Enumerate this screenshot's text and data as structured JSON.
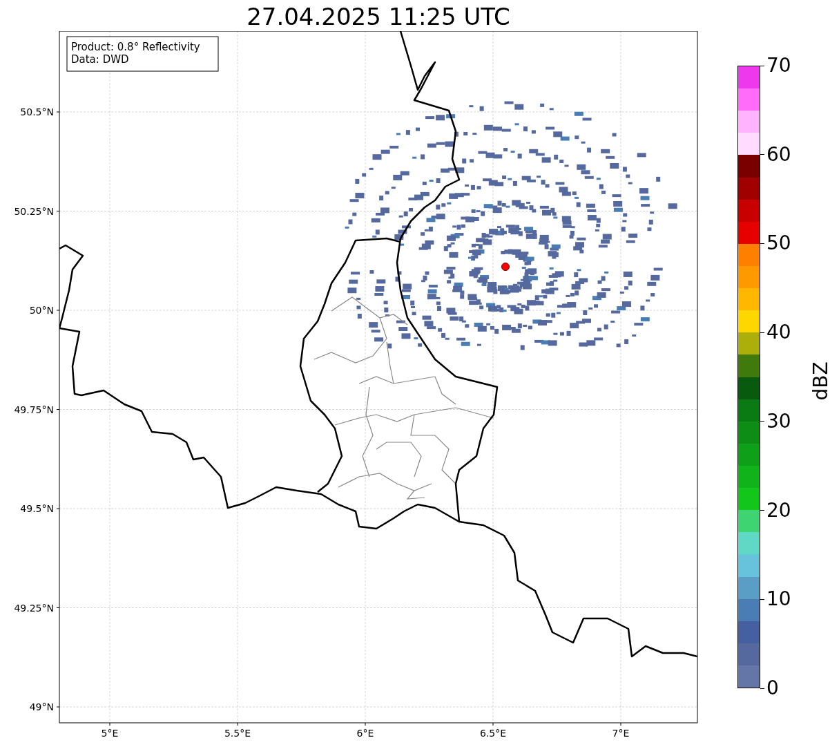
{
  "title": "27.04.2025 11:25 UTC",
  "map": {
    "legend": [
      "Product: 0.8° Reflectivity",
      "Data: DWD"
    ],
    "xticks": [
      "5°E",
      "5.5°E",
      "6°E",
      "6.5°E",
      "7°E"
    ],
    "yticks": [
      "50.5°N",
      "50.25°N",
      "50°N",
      "49.75°N",
      "49.5°N",
      "49.25°N",
      "49°N"
    ]
  },
  "colorbar": {
    "label": "dBZ",
    "ticks": [
      "70",
      "60",
      "50",
      "40",
      "30",
      "20",
      "10",
      "0"
    ],
    "segments": [
      {
        "color": "#ee38ee"
      },
      {
        "color": "#ff6cfa"
      },
      {
        "color": "#ffb3ff"
      },
      {
        "color": "#ffdcff"
      },
      {
        "color": "#7a0000"
      },
      {
        "color": "#a00000"
      },
      {
        "color": "#c80000"
      },
      {
        "color": "#e60000"
      },
      {
        "color": "#ff7f00"
      },
      {
        "color": "#ff9900"
      },
      {
        "color": "#ffb700"
      },
      {
        "color": "#ffd700"
      },
      {
        "color": "#acaf0a"
      },
      {
        "color": "#407a0c"
      },
      {
        "color": "#085a0e"
      },
      {
        "color": "#0a7a12"
      },
      {
        "color": "#0d8c16"
      },
      {
        "color": "#0fa01a"
      },
      {
        "color": "#10b41a"
      },
      {
        "color": "#12c61a"
      },
      {
        "color": "#3fd472"
      },
      {
        "color": "#5fd8c5"
      },
      {
        "color": "#67c3db"
      },
      {
        "color": "#5a9ec6"
      },
      {
        "color": "#4a7db3"
      },
      {
        "color": "#4560a0"
      },
      {
        "color": "#55699f"
      },
      {
        "color": "#6475a8"
      }
    ]
  }
}
